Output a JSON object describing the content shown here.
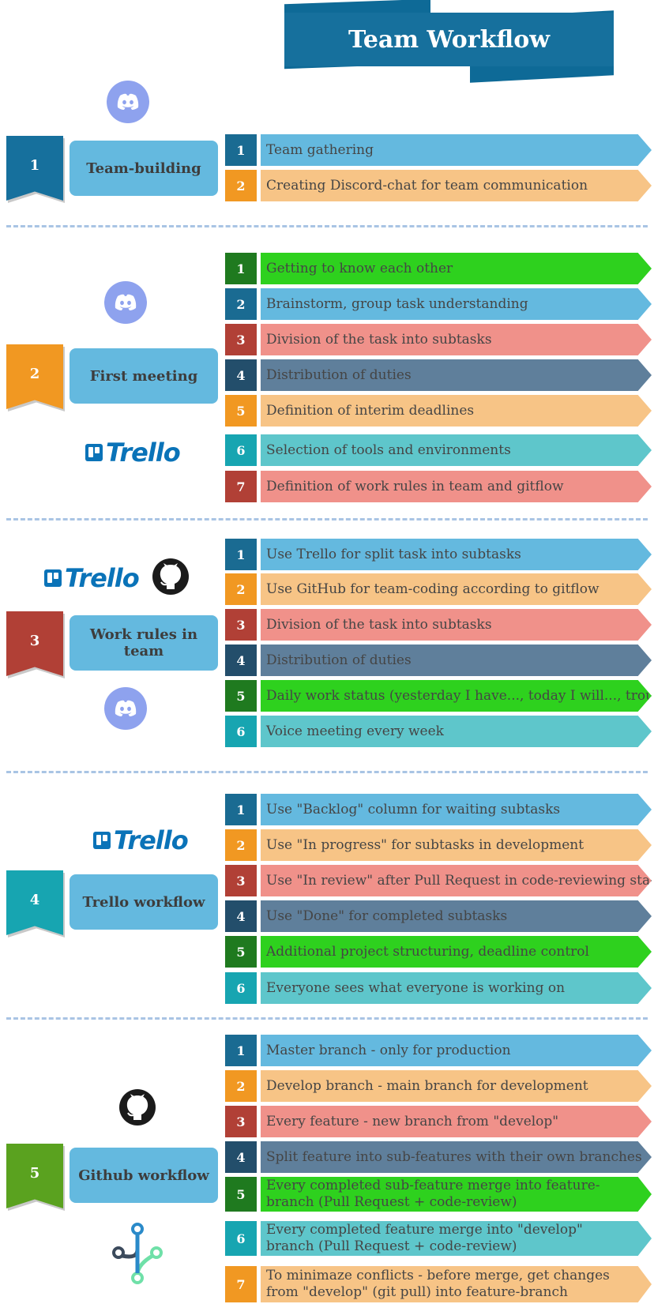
{
  "title": "Team Workflow",
  "colors": {
    "banner": "#16709d",
    "label": "#64b9df",
    "num_blue": "#1a6b92",
    "bar_blue": "#64b9df",
    "num_orange": "#f19822",
    "bar_orange": "#f7c486",
    "num_red": "#b14036",
    "bar_red": "#f0918a",
    "num_navy": "#234e6b",
    "bar_navy": "#5f7f9b",
    "num_green": "#1f7a1f",
    "bar_green": "#2ed11e",
    "num_teal": "#17a5b1",
    "bar_teal": "#5ec6cb"
  },
  "stages": [
    {
      "number": "1",
      "label": "Team-building",
      "badge_color": "#16709d",
      "icons": [
        "discord-icon"
      ],
      "items": [
        {
          "n": "1",
          "text": "Team gathering",
          "scheme": "blue"
        },
        {
          "n": "2",
          "text": "Creating Discord-chat for team communication",
          "scheme": "orange"
        }
      ]
    },
    {
      "number": "2",
      "label": "First meeting",
      "badge_color": "#f19822",
      "icons": [
        "discord-icon",
        "trello-logo"
      ],
      "trello_text": "Trello",
      "items": [
        {
          "n": "1",
          "text": "Getting to know each other",
          "scheme": "green"
        },
        {
          "n": "2",
          "text": "Brainstorm, group task understanding",
          "scheme": "blue"
        },
        {
          "n": "3",
          "text": "Division of the task into subtasks",
          "scheme": "red"
        },
        {
          "n": "4",
          "text": "Distribution of duties",
          "scheme": "navy"
        },
        {
          "n": "5",
          "text": "Definition of interim deadlines",
          "scheme": "orange"
        },
        {
          "n": "6",
          "text": "Selection of tools and environments",
          "scheme": "teal"
        },
        {
          "n": "7",
          "text": "Definition of work rules in team and gitflow",
          "scheme": "red"
        }
      ]
    },
    {
      "number": "3",
      "label": "Work rules in team",
      "badge_color": "#b14036",
      "icons": [
        "trello-logo",
        "github-icon",
        "discord-icon"
      ],
      "trello_text": "Trello",
      "items": [
        {
          "n": "1",
          "text": "Use Trello for split task into subtasks",
          "scheme": "blue"
        },
        {
          "n": "2",
          "text": "Use GitHub for team-coding according to gitflow",
          "scheme": "orange"
        },
        {
          "n": "3",
          "text": "Division of the task into subtasks",
          "scheme": "red"
        },
        {
          "n": "4",
          "text": "Distribution of duties",
          "scheme": "navy"
        },
        {
          "n": "5",
          "text": "Daily work status (yesterday I have..., today I will..., troubles)",
          "scheme": "green"
        },
        {
          "n": "6",
          "text": "Voice meeting every week",
          "scheme": "teal"
        }
      ]
    },
    {
      "number": "4",
      "label": "Trello workflow",
      "badge_color": "#17a5b1",
      "icons": [
        "trello-logo"
      ],
      "trello_text": "Trello",
      "items": [
        {
          "n": "1",
          "text": "Use \"Backlog\" column for waiting subtasks",
          "scheme": "blue"
        },
        {
          "n": "2",
          "text": "Use \"In progress\" for subtasks in development",
          "scheme": "orange"
        },
        {
          "n": "3",
          "text": "Use \"In review\" after Pull Request in code-reviewing stage",
          "scheme": "red"
        },
        {
          "n": "4",
          "text": "Use \"Done\" for completed subtasks",
          "scheme": "navy"
        },
        {
          "n": "5",
          "text": "Additional project structuring, deadline control",
          "scheme": "green"
        },
        {
          "n": "6",
          "text": "Everyone sees what everyone is working on",
          "scheme": "teal"
        }
      ]
    },
    {
      "number": "5",
      "label": "Github workflow",
      "badge_color": "#5aa21f",
      "icons": [
        "github-icon",
        "git-branch-icon"
      ],
      "items": [
        {
          "n": "1",
          "text": "Master branch - only for production",
          "scheme": "blue"
        },
        {
          "n": "2",
          "text": "Develop branch - main branch  for development",
          "scheme": "orange"
        },
        {
          "n": "3",
          "text": "Every feature - new branch from \"develop\"",
          "scheme": "red"
        },
        {
          "n": "4",
          "text": "Split feature into sub-features with their own branches",
          "scheme": "navy"
        },
        {
          "n": "5",
          "text": "Every completed sub-feature merge into feature-branch (Pull Request + code-review)",
          "scheme": "green"
        },
        {
          "n": "6",
          "text": "Every completed feature merge into \"develop\" branch (Pull Request + code-review)",
          "scheme": "teal"
        },
        {
          "n": "7",
          "text": "To minimaze conflicts - before merge, get changes from \"develop\" (git pull) into feature-branch",
          "scheme": "orange"
        }
      ]
    }
  ]
}
